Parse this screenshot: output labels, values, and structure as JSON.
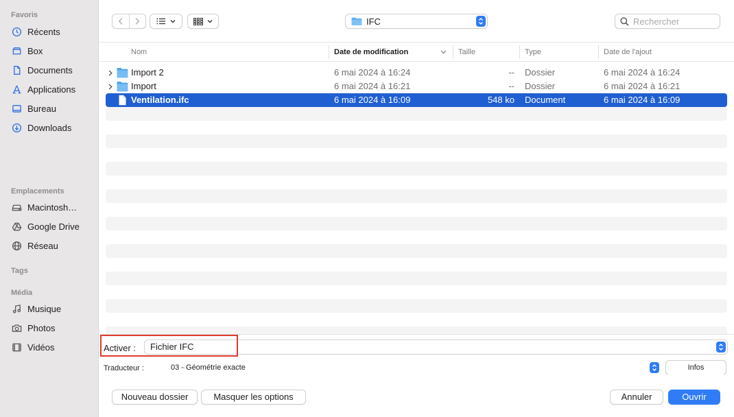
{
  "sidebar": {
    "favorites_title": "Favoris",
    "favorites": [
      {
        "label": "Récents",
        "icon": "clock-icon"
      },
      {
        "label": "Box",
        "icon": "box-icon"
      },
      {
        "label": "Documents",
        "icon": "document-icon"
      },
      {
        "label": "Applications",
        "icon": "applications-icon"
      },
      {
        "label": "Bureau",
        "icon": "desktop-icon"
      },
      {
        "label": "Downloads",
        "icon": "download-icon"
      }
    ],
    "locations_title": "Emplacements",
    "locations": [
      {
        "label": "Macintosh…",
        "icon": "hard-drive-icon"
      },
      {
        "label": "Google Drive",
        "icon": "google-drive-icon"
      },
      {
        "label": "Réseau",
        "icon": "network-icon"
      }
    ],
    "tags_title": "Tags",
    "media_title": "Média",
    "media": [
      {
        "label": "Musique",
        "icon": "music-icon"
      },
      {
        "label": "Photos",
        "icon": "camera-icon"
      },
      {
        "label": "Vidéos",
        "icon": "film-icon"
      }
    ]
  },
  "toolbar": {
    "location": "IFC",
    "search_placeholder": "Rechercher"
  },
  "table": {
    "columns": {
      "name": "Nom",
      "modified": "Date de modification",
      "size": "Taille",
      "type": "Type",
      "added": "Date de l'ajout"
    },
    "rows": [
      {
        "name": "Import 2",
        "modified": "6 mai 2024 à 16:24",
        "size": "--",
        "type": "Dossier",
        "added": "6 mai 2024 à 16:24"
      },
      {
        "name": "Import",
        "modified": "6 mai 2024 à 16:21",
        "size": "--",
        "type": "Dossier",
        "added": "6 mai 2024 à 16:21"
      },
      {
        "name": "Ventilation.ifc",
        "modified": "6 mai 2024 à 16:09",
        "size": "548 ko",
        "type": "Document",
        "added": "6 mai 2024 à 16:09"
      }
    ]
  },
  "options": {
    "enable_label": "Activer :",
    "enable_value": "Fichier IFC",
    "translator_label": "Traducteur :",
    "translator_value": "03 - Géométrie exacte",
    "info_button": "Infos"
  },
  "footer": {
    "new_folder": "Nouveau dossier",
    "hide_options": "Masquer les options",
    "cancel": "Annuler",
    "open": "Ouvrir"
  },
  "colors": {
    "accent": "#2f7cf6",
    "selection": "#1f5fd1",
    "highlight_box": "#e03a2e"
  }
}
